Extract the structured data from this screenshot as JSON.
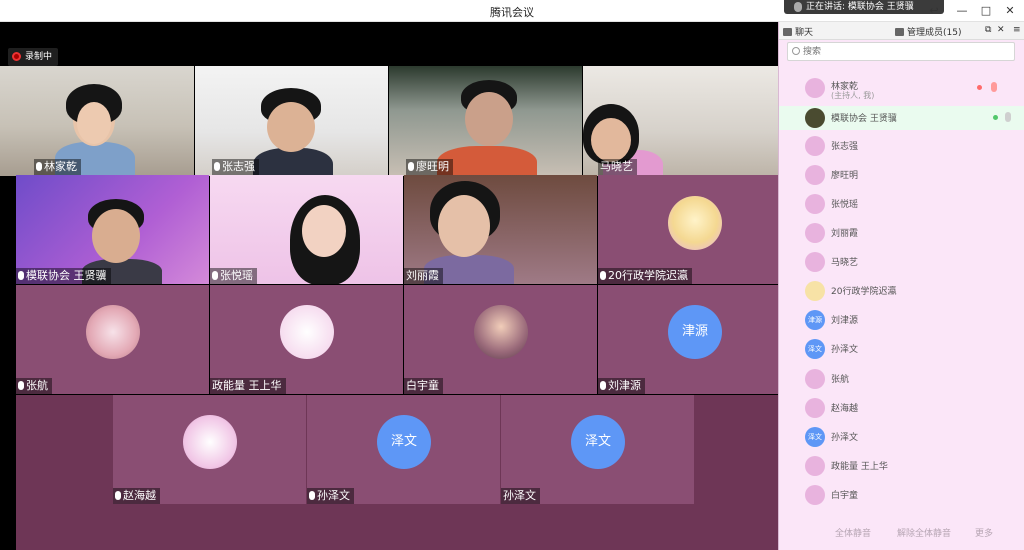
{
  "app_title": "腾讯会议",
  "speaking_text": "正在讲话: 模联协会 王贤骥",
  "window_controls": {
    "minimize": "—",
    "maximize": "□",
    "close": "✕"
  },
  "recording_label": "录制中",
  "top_row": [
    {
      "name": "林家乾"
    },
    {
      "name": "张志强"
    },
    {
      "name": "廖旺明"
    },
    {
      "name": "马晓艺"
    }
  ],
  "grid": [
    {
      "name": "模联协会 王贤骥"
    },
    {
      "name": "张悦瑶"
    },
    {
      "name": "刘丽霞"
    },
    {
      "name": "20行政学院迟瀛"
    },
    {
      "name": "张航"
    },
    {
      "name": "政能量 王上华"
    },
    {
      "name": "白宇童"
    },
    {
      "name": "刘津源",
      "avatar_text": "津源"
    },
    {
      "name": "赵海越"
    },
    {
      "name": "孙泽文",
      "avatar_text": "泽文"
    },
    {
      "name": "孙泽文",
      "avatar_text": "泽文"
    }
  ],
  "sidebar": {
    "tab_chat": "聊天",
    "tab_members": "管理成员(15)",
    "search_placeholder": "搜索",
    "members": [
      {
        "name": "林家乾",
        "sub": "(主持人, 我)"
      },
      {
        "name": "模联协会 王贤骥"
      },
      {
        "name": "张志强"
      },
      {
        "name": "廖旺明"
      },
      {
        "name": "张悦瑶"
      },
      {
        "name": "刘丽霞"
      },
      {
        "name": "马晓艺"
      },
      {
        "name": "20行政学院迟瀛"
      },
      {
        "name": "刘津源",
        "avatar_text": "津源"
      },
      {
        "name": "孙泽文",
        "avatar_text": "泽文"
      },
      {
        "name": "张航"
      },
      {
        "name": "赵海越"
      },
      {
        "name": "孙泽文",
        "avatar_text": "泽文"
      },
      {
        "name": "政能量 王上华"
      },
      {
        "name": "白宇童"
      }
    ],
    "footer": [
      "全体静音",
      "解除全体静音",
      "更多"
    ]
  }
}
